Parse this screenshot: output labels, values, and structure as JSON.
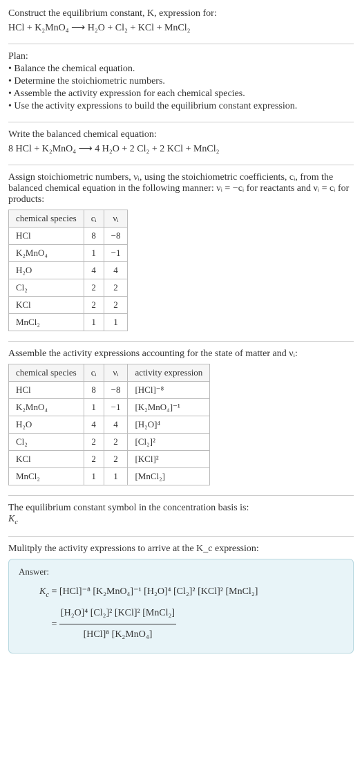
{
  "intro": {
    "line1": "Construct the equilibrium constant, K, expression for:",
    "eq": "HCl + K₂MnO₄  ⟶  H₂O + Cl₂ + KCl + MnCl₂"
  },
  "plan": {
    "title": "Plan:",
    "b1": "• Balance the chemical equation.",
    "b2": "• Determine the stoichiometric numbers.",
    "b3": "• Assemble the activity expression for each chemical species.",
    "b4": "• Use the activity expressions to build the equilibrium constant expression."
  },
  "balanced": {
    "title": "Write the balanced chemical equation:",
    "eq": "8 HCl + K₂MnO₄  ⟶  4 H₂O + 2 Cl₂ + 2 KCl + MnCl₂"
  },
  "assign": {
    "text": "Assign stoichiometric numbers, νᵢ, using the stoichiometric coefficients, cᵢ, from the balanced chemical equation in the following manner: νᵢ = −cᵢ for reactants and νᵢ = cᵢ for products:"
  },
  "table1": {
    "h1": "chemical species",
    "h2": "cᵢ",
    "h3": "νᵢ",
    "rows": [
      {
        "s": "HCl",
        "c": "8",
        "v": "−8"
      },
      {
        "s": "K₂MnO₄",
        "c": "1",
        "v": "−1"
      },
      {
        "s": "H₂O",
        "c": "4",
        "v": "4"
      },
      {
        "s": "Cl₂",
        "c": "2",
        "v": "2"
      },
      {
        "s": "KCl",
        "c": "2",
        "v": "2"
      },
      {
        "s": "MnCl₂",
        "c": "1",
        "v": "1"
      }
    ]
  },
  "assemble": {
    "text": "Assemble the activity expressions accounting for the state of matter and νᵢ:"
  },
  "table2": {
    "h1": "chemical species",
    "h2": "cᵢ",
    "h3": "νᵢ",
    "h4": "activity expression",
    "rows": [
      {
        "s": "HCl",
        "c": "8",
        "v": "−8",
        "a": "[HCl]⁻⁸"
      },
      {
        "s": "K₂MnO₄",
        "c": "1",
        "v": "−1",
        "a": "[K₂MnO₄]⁻¹"
      },
      {
        "s": "H₂O",
        "c": "4",
        "v": "4",
        "a": "[H₂O]⁴"
      },
      {
        "s": "Cl₂",
        "c": "2",
        "v": "2",
        "a": "[Cl₂]²"
      },
      {
        "s": "KCl",
        "c": "2",
        "v": "2",
        "a": "[KCl]²"
      },
      {
        "s": "MnCl₂",
        "c": "1",
        "v": "1",
        "a": "[MnCl₂]"
      }
    ]
  },
  "symbol": {
    "line1": "The equilibrium constant symbol in the concentration basis is:",
    "line2": "K_c"
  },
  "multiply": {
    "text": "Mulitply the activity expressions to arrive at the K_c expression:"
  },
  "answer": {
    "label": "Answer:",
    "kc": "K_c",
    "line1": "= [HCl]⁻⁸ [K₂MnO₄]⁻¹ [H₂O]⁴ [Cl₂]² [KCl]² [MnCl₂]",
    "num": "[H₂O]⁴ [Cl₂]² [KCl]² [MnCl₂]",
    "den": "[HCl]⁸ [K₂MnO₄]",
    "eq2prefix": "= "
  },
  "chart_data": {
    "type": "table",
    "tables": [
      {
        "columns": [
          "chemical species",
          "cᵢ",
          "νᵢ"
        ],
        "rows": [
          [
            "HCl",
            8,
            -8
          ],
          [
            "K₂MnO₄",
            1,
            -1
          ],
          [
            "H₂O",
            4,
            4
          ],
          [
            "Cl₂",
            2,
            2
          ],
          [
            "KCl",
            2,
            2
          ],
          [
            "MnCl₂",
            1,
            1
          ]
        ]
      },
      {
        "columns": [
          "chemical species",
          "cᵢ",
          "νᵢ",
          "activity expression"
        ],
        "rows": [
          [
            "HCl",
            8,
            -8,
            "[HCl]^-8"
          ],
          [
            "K₂MnO₄",
            1,
            -1,
            "[K₂MnO₄]^-1"
          ],
          [
            "H₂O",
            4,
            4,
            "[H₂O]^4"
          ],
          [
            "Cl₂",
            2,
            2,
            "[Cl₂]^2"
          ],
          [
            "KCl",
            2,
            2,
            "[KCl]^2"
          ],
          [
            "MnCl₂",
            1,
            1,
            "[MnCl₂]"
          ]
        ]
      }
    ]
  }
}
